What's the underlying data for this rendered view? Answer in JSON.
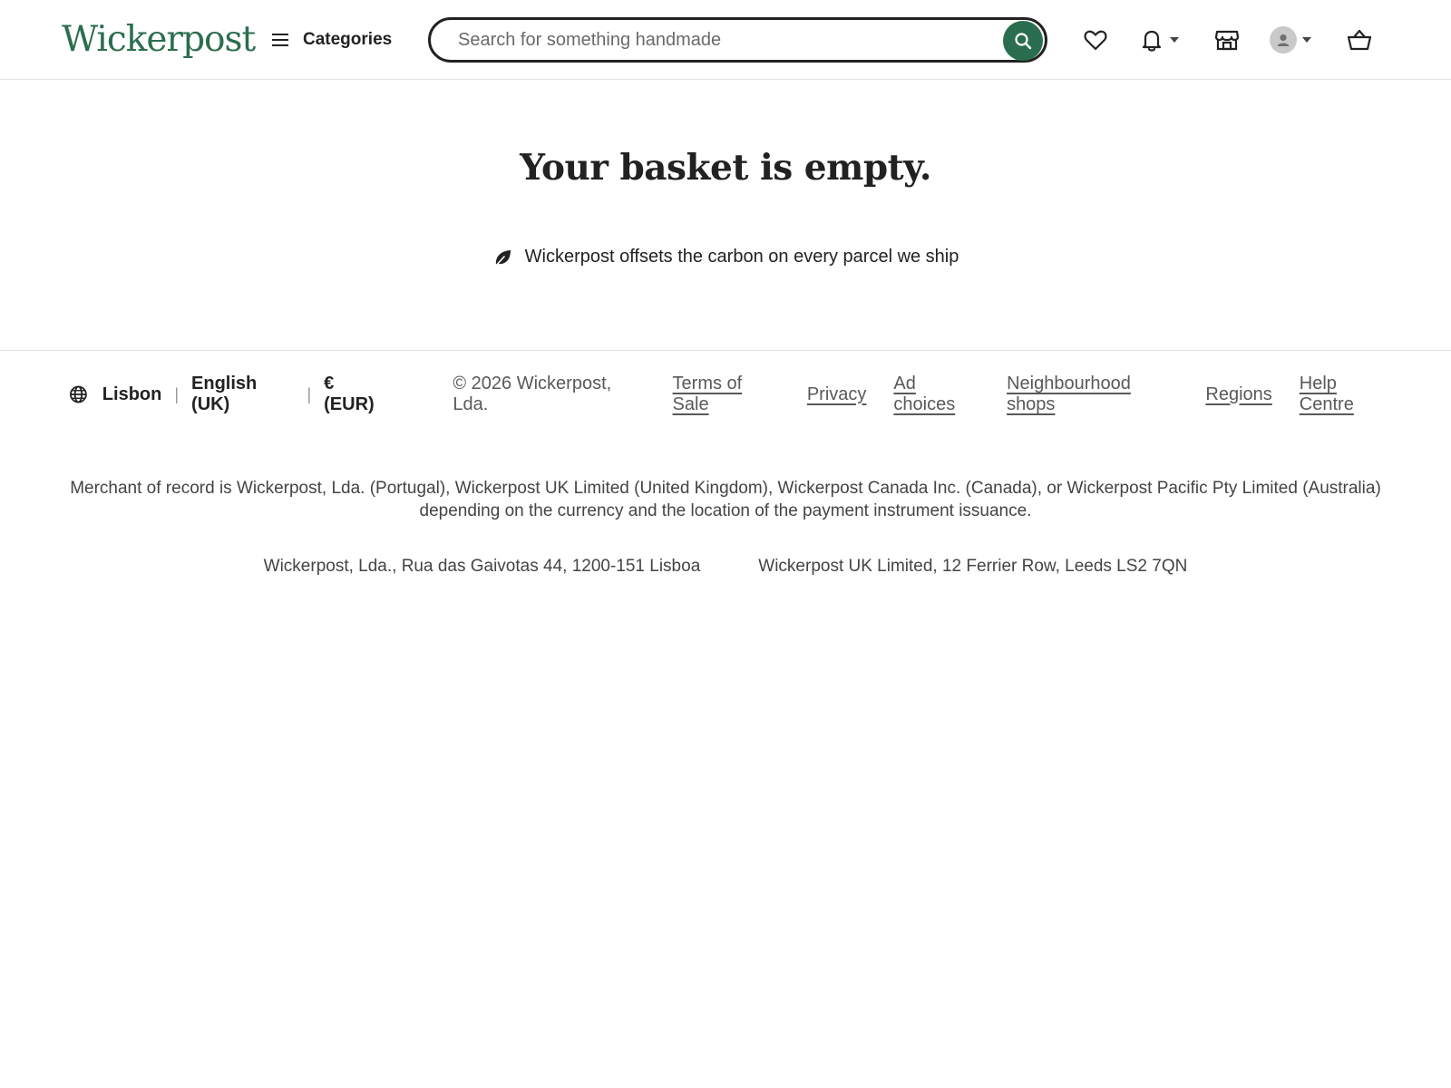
{
  "header": {
    "logo": "Wickerpost",
    "categories_label": "Categories",
    "search_placeholder": "Search for something handmade",
    "icons": [
      "menu-icon",
      "search-icon",
      "heart-icon",
      "bell-icon",
      "shop-icon",
      "avatar-icon",
      "basket-icon"
    ]
  },
  "main": {
    "title": "Your basket is empty.",
    "carbon_text": "Wickerpost offsets the carbon on every parcel we ship",
    "carbon_icon": "leaf-icon"
  },
  "footer": {
    "region": "Lisbon",
    "language": "English (UK)",
    "currency": "€ (EUR)",
    "separator": "|",
    "copyright": "© 2026 Wickerpost, Lda.",
    "links": [
      "Terms of Sale",
      "Privacy",
      "Ad choices",
      "Neighbourhood shops",
      "Regions",
      "Help Centre"
    ],
    "merchant_line1": "Merchant of record is Wickerpost, Lda. (Portugal), Wickerpost UK Limited (United Kingdom), Wickerpost Canada Inc. (Canada), or Wickerpost Pacific Pty Limited (Australia)",
    "merchant_line2": "depending on the currency and the location of the payment instrument issuance.",
    "address_pt": "Wickerpost, Lda., Rua das Gaivotas 44, 1200-151 Lisboa",
    "address_uk": "Wickerpost UK Limited, 12 Ferrier Row, Leeds LS2 7QN"
  },
  "colors": {
    "brand": "#2b6e4f",
    "text": "#222222",
    "muted": "#595959",
    "divider": "#e1e3df"
  }
}
